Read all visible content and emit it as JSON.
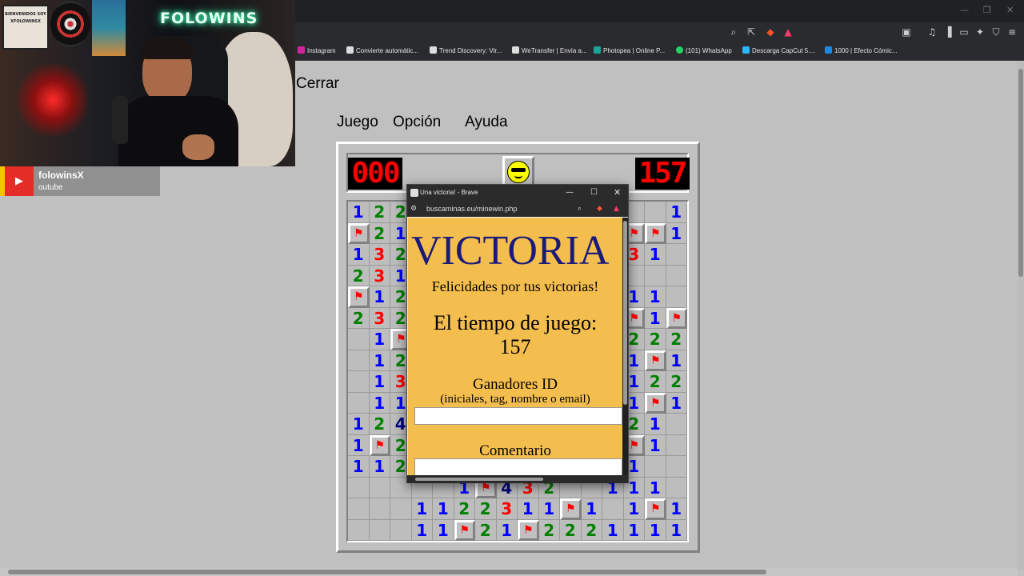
{
  "browser": {
    "url_icons": [
      "zoom-icon",
      "share-icon",
      "brave-shield-icon",
      "rewards-icon",
      "music-icon",
      "sidebar-icon",
      "wallet-icon",
      "leo-icon",
      "vpn-icon",
      "menu-icon"
    ],
    "bookmarks": [
      {
        "label": "Instagram",
        "color": "#d6249f"
      },
      {
        "label": "Convierte automátic...",
        "color": "#ffffff"
      },
      {
        "label": "Trend Discovery: Vir...",
        "color": "#ffffff"
      },
      {
        "label": "WeTransfer | Envía a...",
        "color": "#ffffff"
      },
      {
        "label": "Photopea | Online P...",
        "color": "#18a497"
      },
      {
        "label": "(101) WhatsApp",
        "color": "#25d366"
      },
      {
        "label": "Descarga CapCut 5....",
        "color": "#29b6f6"
      },
      {
        "label": "1000 | Efecto Cómic...",
        "color": "#1e88e5"
      }
    ]
  },
  "overlay": {
    "channel_name": "folowinsX",
    "platform": "outube",
    "neon_sign": "FOLOWINS",
    "poster_text": "BIENVENIDOS SOY XFOLOWINSX"
  },
  "page": {
    "close_link": "Cerrar",
    "menu": [
      "Juego",
      "Opción",
      "Ayuda"
    ]
  },
  "game": {
    "mines_counter": "000",
    "timer": "157",
    "face": "sunglasses-face",
    "colors": {
      "n1": "#0000ff",
      "n2": "#008000",
      "n3": "#ff0000",
      "n4": "#000080"
    },
    "rows": [
      "122____________1",
      "F21______4131FF1",
      "132______F31F31_",
      "231______21F1___",
      "F12_______F1_11_",
      "232______1_11F1F",
      "_1F______F_22222",
      "_12______1_F21F1",
      "_13______2_1F122",
      "_11______1__11F1",
      "124______3_F121_",
      "1F2______F_F1F1_",
      "112______2__11__",
      "_____1F432__111_",
      "___1122311F1_1F1",
      "___11F21F2221111"
    ]
  },
  "popup": {
    "title": "Una victoria! - Brave",
    "url": "buscaminas.eu/minewin.php",
    "heading": "VICTORIA",
    "subtitle": "Felicidades por tus victorias!",
    "time_label": "El tiempo de juego:",
    "time_value": "157",
    "winner_label": "Ganadores ID",
    "winner_hint": "(iniciales, tag, nombre o email)",
    "winner_value": "",
    "comment_label": "Comentario",
    "comment_value": "",
    "bg_color": "#f4be4e",
    "heading_color": "#1a1a7a"
  }
}
